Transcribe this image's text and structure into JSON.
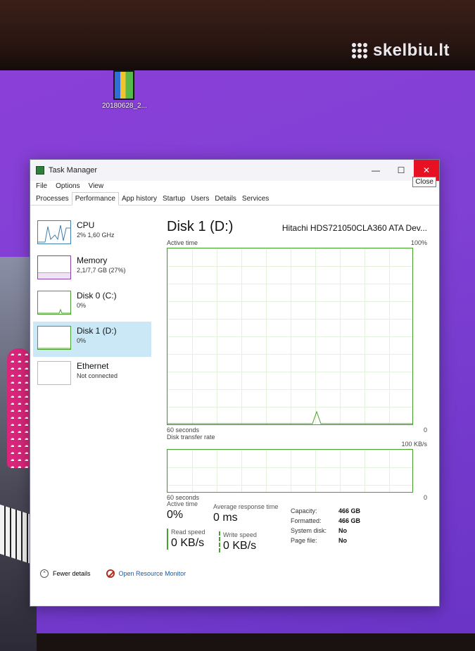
{
  "watermark": "skelbiu.lt",
  "desktop": {
    "icon_label": "20180628_2..."
  },
  "window": {
    "title": "Task Manager",
    "close_tooltip": "Close"
  },
  "menu": [
    "File",
    "Options",
    "View"
  ],
  "tabs": [
    "Processes",
    "Performance",
    "App history",
    "Startup",
    "Users",
    "Details",
    "Services"
  ],
  "active_tab": "Performance",
  "devices": [
    {
      "name": "CPU",
      "sub": "2% 1,60 GHz",
      "icon": "cpu-graph-icon"
    },
    {
      "name": "Memory",
      "sub": "2,1/7,7 GB (27%)",
      "icon": "memory-graph-icon"
    },
    {
      "name": "Disk 0 (C:)",
      "sub": "0%",
      "icon": "disk-graph-icon"
    },
    {
      "name": "Disk 1 (D:)",
      "sub": "0%",
      "icon": "disk-graph-icon",
      "selected": true
    },
    {
      "name": "Ethernet",
      "sub": "Not connected",
      "icon": "ethernet-graph-icon"
    }
  ],
  "detail": {
    "title": "Disk 1 (D:)",
    "model": "Hitachi HDS721050CLA360 ATA Dev...",
    "chart1": {
      "label": "Active time",
      "max": "100%",
      "x_label": "60 seconds",
      "min": "0"
    },
    "chart2": {
      "label": "Disk transfer rate",
      "max": "100 KB/s",
      "x_label": "60 seconds",
      "min": "0"
    }
  },
  "stats": {
    "active_time_label": "Active time",
    "active_time_value": "0%",
    "avg_response_label": "Average response time",
    "avg_response_value": "0 ms",
    "read_label": "Read speed",
    "read_value": "0 KB/s",
    "write_label": "Write speed",
    "write_value": "0 KB/s"
  },
  "properties": [
    {
      "key": "Capacity:",
      "value": "466 GB"
    },
    {
      "key": "Formatted:",
      "value": "466 GB"
    },
    {
      "key": "System disk:",
      "value": "No"
    },
    {
      "key": "Page file:",
      "value": "No"
    }
  ],
  "footer": {
    "fewer_details": "Fewer details",
    "open_monitor": "Open Resource Monitor"
  },
  "colors": {
    "disk": "#4aa02c",
    "cpu": "#3c7fb0",
    "memory": "#8b3fa8",
    "desktop": "#8040d4",
    "close": "#e81123"
  }
}
